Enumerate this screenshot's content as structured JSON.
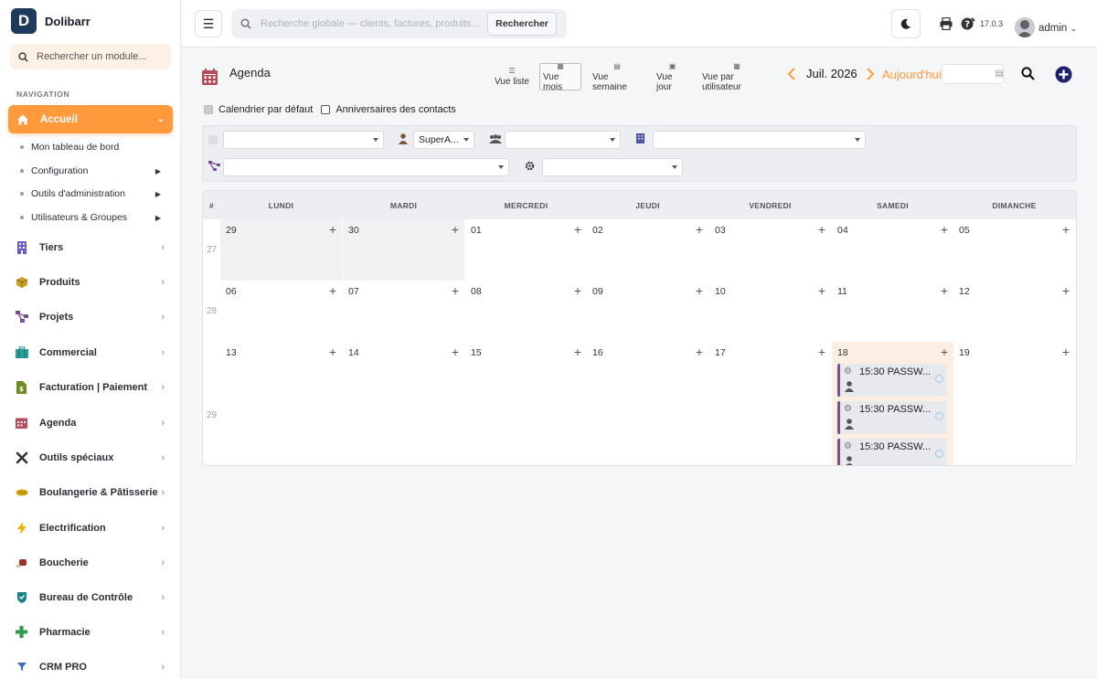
{
  "brand": {
    "logo_letter": "D",
    "name": "Dolibarr"
  },
  "sidebar": {
    "search_placeholder": "Rechercher un module...",
    "nav_title": "NAVIGATION",
    "active": {
      "label": "Accueil"
    },
    "subitems": [
      {
        "label": "Mon tableau de bord"
      },
      {
        "label": "Configuration"
      },
      {
        "label": "Outils d'administration"
      },
      {
        "label": "Utilisateurs & Groupes"
      }
    ],
    "items": [
      {
        "label": "Tiers",
        "icon": "building-icon",
        "color": "#6a5acd"
      },
      {
        "label": "Produits",
        "icon": "box-icon",
        "color": "#b8860b"
      },
      {
        "label": "Projets",
        "icon": "sitemap-icon",
        "color": "#7a4f8f"
      },
      {
        "label": "Commercial",
        "icon": "briefcase-icon",
        "color": "#2aa198"
      },
      {
        "label": "Facturation | Paiement",
        "icon": "invoice-icon",
        "color": "#6b8e23"
      },
      {
        "label": "Agenda",
        "icon": "calendar-icon",
        "color": "#b44b5a"
      },
      {
        "label": "Outils spéciaux",
        "icon": "tools-icon",
        "color": "#333"
      },
      {
        "label": "Boulangerie & Pâtisserie",
        "icon": "bread-icon",
        "color": "#d8a500"
      },
      {
        "label": "Electrification",
        "icon": "bolt-icon",
        "color": "#f0b400"
      },
      {
        "label": "Boucherie",
        "icon": "meat-icon",
        "color": "#a0322a"
      },
      {
        "label": "Bureau de Contrôle",
        "icon": "shield-icon",
        "color": "#16808a"
      },
      {
        "label": "Pharmacie",
        "icon": "cross-icon",
        "color": "#2e9a4a"
      },
      {
        "label": "CRM PRO",
        "icon": "funnel-icon",
        "color": "#3d6fb6"
      }
    ]
  },
  "topbar": {
    "search_placeholder": "Recherche globale — clients, factures, produits...",
    "search_button": "Rechercher",
    "version": "17.0.3",
    "user": "admin"
  },
  "agenda": {
    "title": "Agenda",
    "views": [
      {
        "label": "Vue liste",
        "active": false
      },
      {
        "label": "Vue mois",
        "active": true
      },
      {
        "label": "Vue semaine",
        "active": false
      },
      {
        "label": "Vue jour",
        "active": false
      },
      {
        "label": "Vue par utilisateur",
        "active": false
      }
    ],
    "month": "Juil. 2026",
    "today": "Aujourd'hui",
    "check_default": "Calendrier par défaut",
    "check_birthdays": "Anniversaires des contacts",
    "filter_user": "SuperA...",
    "weekdays": [
      "#",
      "LUNDI",
      "MARDI",
      "MERCREDI",
      "JEUDI",
      "VENDREDI",
      "SAMEDI",
      "DIMANCHE"
    ],
    "weeks": [
      {
        "num": "27",
        "days": [
          "29",
          "30",
          "01",
          "02",
          "03",
          "04",
          "05"
        ]
      },
      {
        "num": "28",
        "days": [
          "06",
          "07",
          "08",
          "09",
          "10",
          "11",
          "12"
        ]
      },
      {
        "num": "29",
        "days": [
          "13",
          "14",
          "15",
          "16",
          "17",
          "18",
          "19"
        ]
      }
    ],
    "events": [
      {
        "text": "15:30 PASSW..."
      },
      {
        "text": "15:30 PASSW..."
      },
      {
        "text": "15:30 PASSW..."
      }
    ]
  },
  "colors": {
    "accent": "#ff9a3c",
    "event_bar": "#7a4f8f",
    "today_bg": "#fdeee3"
  }
}
